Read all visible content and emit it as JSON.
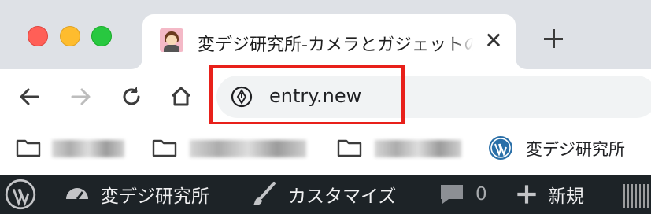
{
  "window": {
    "controls": [
      "close",
      "minimize",
      "maximize"
    ]
  },
  "tab": {
    "title": "変デジ研究所-カメラとガジェットのレビューブログ",
    "favicon": "avatar-icon",
    "close_icon": "close-icon"
  },
  "new_tab_icon": "plus-icon",
  "toolbar": {
    "back_icon": "back-arrow-icon",
    "forward_icon": "forward-arrow-icon",
    "reload_icon": "reload-icon",
    "home_icon": "home-icon",
    "site_info_icon": "pen-nib-icon",
    "url": "entry.new"
  },
  "colors": {
    "highlight": "#e8201a",
    "adminbar": "#1d2327",
    "tabstrip": "#dee1e6"
  },
  "bookmarks": {
    "items": [
      {
        "type": "folder",
        "label": ""
      },
      {
        "type": "folder",
        "label": ""
      },
      {
        "type": "folder",
        "label": ""
      },
      {
        "type": "site",
        "icon": "wordpress-icon",
        "label": "変デジ研究所"
      }
    ]
  },
  "adminbar": {
    "wp_icon": "wordpress-icon",
    "site_name": "変デジ研究所",
    "customize": "カスタマイズ",
    "comments_count": "0",
    "new_label": "新規"
  }
}
